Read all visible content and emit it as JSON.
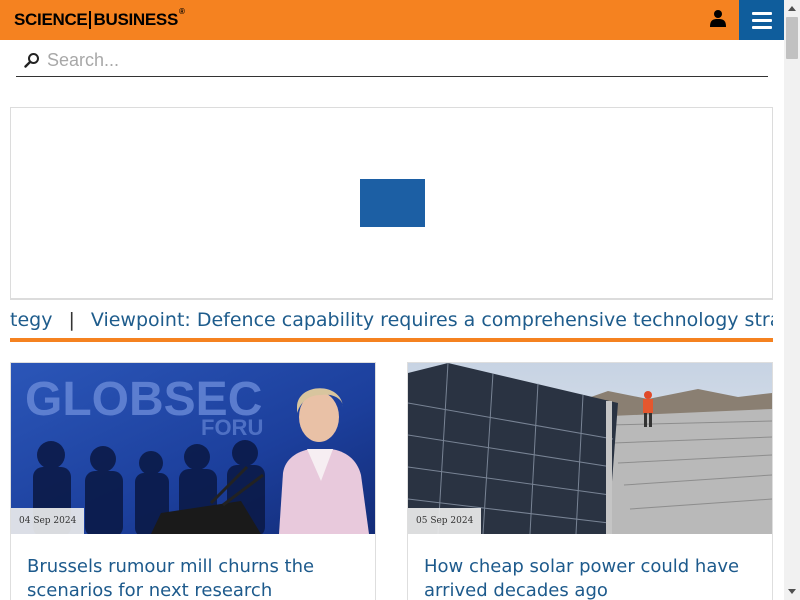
{
  "header": {
    "logo_left": "SCIENCE",
    "logo_right": "BUSINESS",
    "logo_mark": "®",
    "user_icon": "user-icon",
    "menu_icon": "hamburger-menu-icon",
    "brand_color": "#f58220",
    "menu_color": "#0f5d9c"
  },
  "search": {
    "placeholder": "Search...",
    "value": "",
    "icon": "search-icon"
  },
  "ad": {
    "block_color": "#1c5fa4"
  },
  "ticker": {
    "prev_fragment": "tegy",
    "separator": "|",
    "headline": "Viewpoint: Defence capability requires a comprehensive technology strategy",
    "text_color": "#1e5c8c"
  },
  "articles": [
    {
      "date": "04 Sep 2024",
      "title": "Brussels rumour mill churns the scenarios for next research"
    },
    {
      "date": "05 Sep 2024",
      "title": "How cheap solar power could have arrived decades ago"
    }
  ]
}
